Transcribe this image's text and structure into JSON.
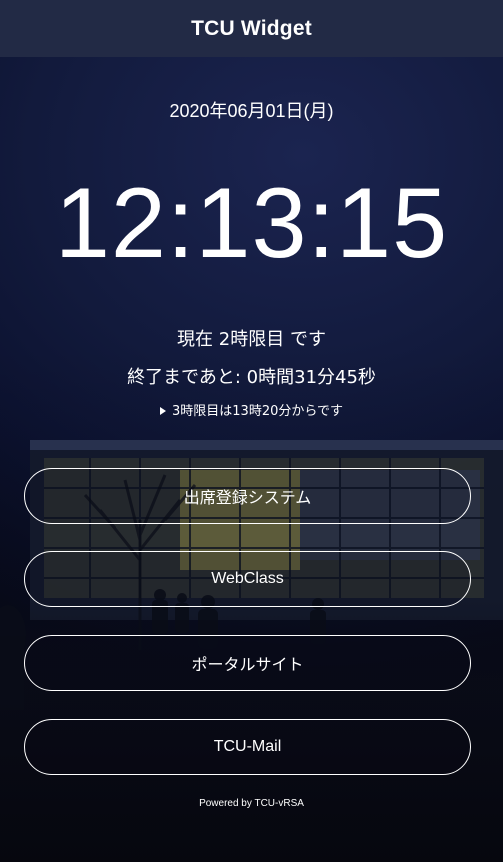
{
  "header": {
    "title": "TCU Widget"
  },
  "clock": {
    "date": "2020年06月01日(月)",
    "time": "12:13:15"
  },
  "status": {
    "current_period": "現在 2時限目 です",
    "remaining": "終了まであと: 0時間31分45秒",
    "next_period": "3時限目は13時20分からです"
  },
  "links": [
    {
      "label": "出席登録システム"
    },
    {
      "label": "WebClass"
    },
    {
      "label": "ポータルサイト"
    },
    {
      "label": "TCU-Mail"
    }
  ],
  "footer": {
    "text": "Powered by TCU-vRSA"
  },
  "colors": {
    "titlebar": "#222a45",
    "background": "#121a3c",
    "text": "#ffffff"
  }
}
